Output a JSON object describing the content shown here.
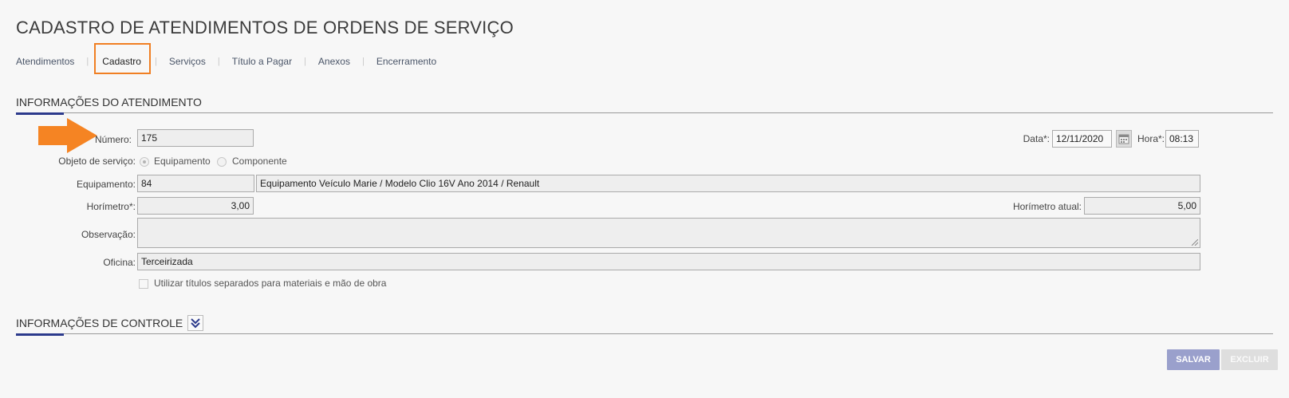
{
  "page": {
    "title": "CADASTRO DE ATENDIMENTOS DE ORDENS DE SERVIÇO"
  },
  "tabs": [
    {
      "label": "Atendimentos"
    },
    {
      "label": "Cadastro"
    },
    {
      "label": "Serviços"
    },
    {
      "label": "Título a Pagar"
    },
    {
      "label": "Anexos"
    },
    {
      "label": "Encerramento"
    }
  ],
  "active_tab": "Cadastro",
  "section_info": {
    "title": "INFORMAÇÕES DO ATENDIMENTO"
  },
  "form": {
    "numero": {
      "label": "Número:",
      "value": "175"
    },
    "data": {
      "label": "Data*:",
      "value": "12/11/2020"
    },
    "hora": {
      "label": "Hora*:",
      "value": "08:13"
    },
    "objeto": {
      "label": "Objeto de serviço:",
      "options": [
        "Equipamento",
        "Componente"
      ],
      "selected": "Equipamento"
    },
    "equipamento": {
      "label": "Equipamento:",
      "code": "84",
      "description": "Equipamento Veículo Marie / Modelo Clio 16V Ano 2014 / Renault"
    },
    "horimetro": {
      "label": "Horímetro*:",
      "value": "3,00"
    },
    "horimetro_atual": {
      "label": "Horímetro atual:",
      "value": "5,00"
    },
    "observacao": {
      "label": "Observação:",
      "value": ""
    },
    "oficina": {
      "label": "Oficina:",
      "value": "Terceirizada"
    },
    "titulos_separados": {
      "label": "Utilizar títulos separados para materiais e mão de obra",
      "checked": false
    }
  },
  "section_control": {
    "title": "INFORMAÇÕES DE CONTROLE"
  },
  "actions": {
    "save": "SALVAR",
    "delete": "EXCLUIR"
  },
  "colors": {
    "highlight": "#f07f23",
    "accent": "#2c3a8c",
    "save_button": "#9aa0cc"
  }
}
